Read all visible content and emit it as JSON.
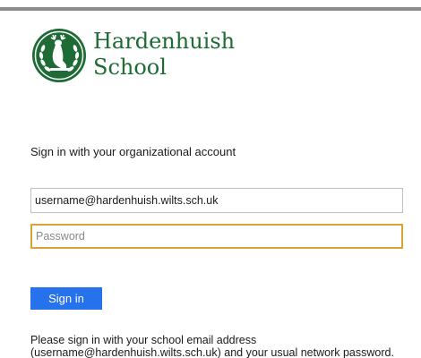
{
  "branding": {
    "school_name_line1": "Hardenhuish",
    "school_name_line2": "School",
    "logo_icon": "stag-crest-icon",
    "brand_color": "#1e6b35"
  },
  "signin": {
    "heading": "Sign in with your organizational account",
    "username_value": "username@hardenhuish.wilts.sch.uk",
    "password_placeholder": "Password",
    "button_label": "Sign in",
    "button_color": "#2672ec",
    "focus_border_color": "#d8a43a"
  },
  "help": {
    "line1": "Please sign in with your school email address",
    "line2": "(username@hardenhuish.wilts.sch.uk) and your usual network password."
  }
}
